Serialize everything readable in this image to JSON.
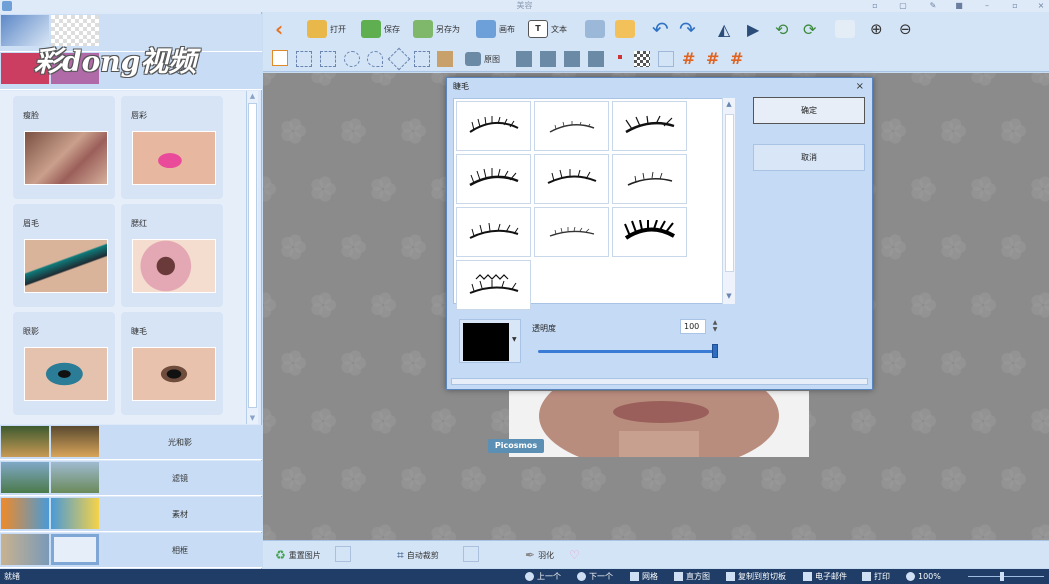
{
  "window": {
    "title": "美容"
  },
  "sidebar": {
    "top_label": "美容",
    "logo_text": "彩dong视频",
    "cards": [
      {
        "label": "瘦脸"
      },
      {
        "label": "唇彩"
      },
      {
        "label": "眉毛"
      },
      {
        "label": "腮红"
      },
      {
        "label": "眼影"
      },
      {
        "label": "睫毛"
      }
    ],
    "categories": [
      {
        "label": "光和影"
      },
      {
        "label": "滤镜"
      },
      {
        "label": "素材"
      },
      {
        "label": "相框"
      }
    ]
  },
  "toolbar": {
    "open": "打开",
    "save": "保存",
    "save_as": "另存为",
    "canvas": "画布",
    "text": "文本",
    "original": "原图"
  },
  "bottombar": {
    "reset": "重置图片",
    "crop": "自动裁剪",
    "feather": "羽化"
  },
  "statusbar": {
    "status": "就绪",
    "prev": "上一个",
    "next": "下一个",
    "grid": "网格",
    "histogram": "直方图",
    "copy": "复制到剪切板",
    "email": "电子邮件",
    "print": "打印",
    "zoom": "100%"
  },
  "dialog": {
    "title": "睫毛",
    "ok": "确定",
    "cancel": "取消",
    "opacity_label": "透明度",
    "opacity_value": "100",
    "opacity_fraction": 1.0,
    "color": "#000000"
  },
  "watermark": "Picosmos",
  "colors": {
    "accent": "#3a7bd5",
    "sidebar": "#dde9f8",
    "toolbar": "#d4e4f7"
  }
}
